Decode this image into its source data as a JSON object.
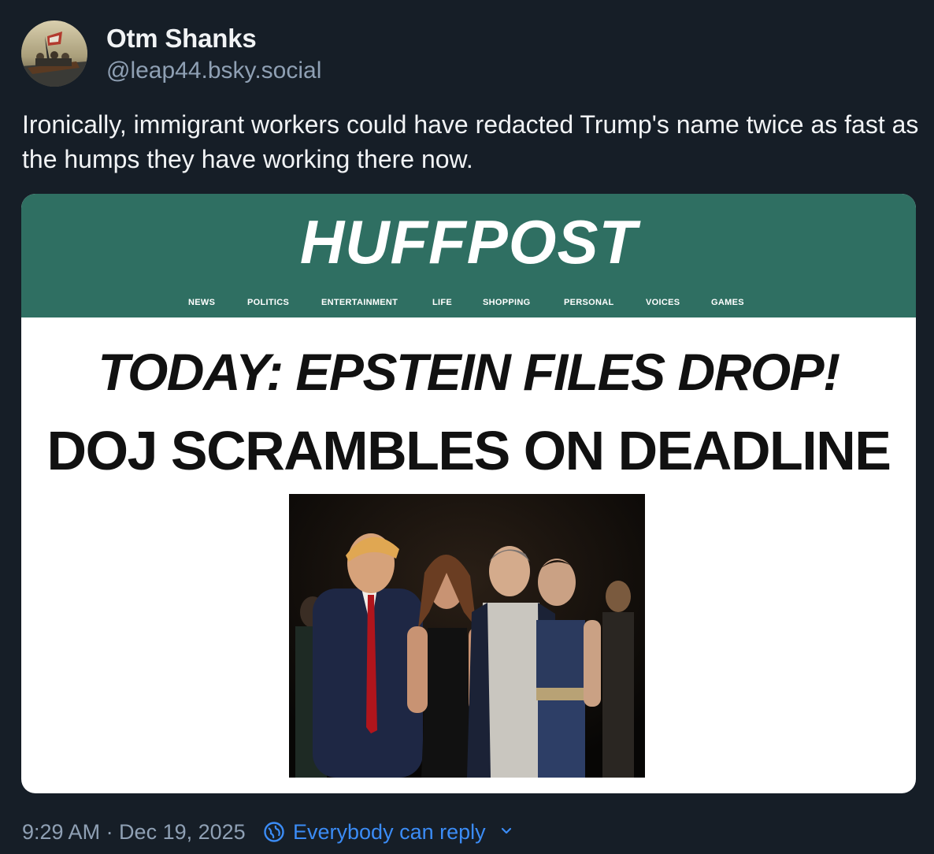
{
  "author": {
    "display_name": "Otm Shanks",
    "handle": "@leap44.bsky.social",
    "avatar_icon": "avatar-painting"
  },
  "post": {
    "text": "Ironically, immigrant workers could have redacted Trump's name twice as fast as the humps they have working there now."
  },
  "embed": {
    "logo": "HUFFPOST",
    "nav": [
      "NEWS",
      "POLITICS",
      "ENTERTAINMENT",
      "LIFE",
      "SHOPPING",
      "PERSONAL",
      "VOICES",
      "GAMES"
    ],
    "headline_1": "TODAY: EPSTEIN FILES DROP!",
    "headline_2": "DOJ SCRAMBLES ON DEADLINE",
    "brand_color": "#2f6f62"
  },
  "footer": {
    "timestamp": "9:29 AM · Dec 19, 2025",
    "reply_setting": "Everybody can reply"
  },
  "colors": {
    "background": "#161e27",
    "accent": "#3b8cf6",
    "muted": "#8fa0b4"
  }
}
